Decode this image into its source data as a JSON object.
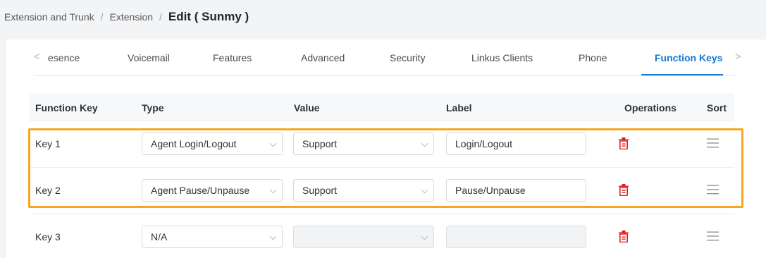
{
  "breadcrumb": {
    "items": [
      "Extension and Trunk",
      "Extension"
    ],
    "separator": "/",
    "current": "Edit ( Sunmy )"
  },
  "tabs": {
    "prev_icon": "chevron-left-icon",
    "next_icon": "chevron-right-icon",
    "prev_glyph": "<",
    "next_glyph": ">",
    "items": [
      "esence",
      "Voicemail",
      "Features",
      "Advanced",
      "Security",
      "Linkus Clients",
      "Phone",
      "Function Keys"
    ],
    "active": "Function Keys",
    "active_color": "#1677d2"
  },
  "table": {
    "headers": [
      "Function Key",
      "Type",
      "Value",
      "Label",
      "Operations",
      "Sort"
    ],
    "rows": [
      {
        "key": "Key 1",
        "type": "Agent Login/Logout",
        "value": "Support",
        "label": "Login/Logout",
        "disabled": false
      },
      {
        "key": "Key 2",
        "type": "Agent Pause/Unpause",
        "value": "Support",
        "label": "Pause/Unpause",
        "disabled": false
      },
      {
        "key": "Key 3",
        "type": "N/A",
        "value": "",
        "label": "",
        "disabled": true
      }
    ],
    "operation_icon": "trash-icon",
    "sort_icon": "drag-handle-icon"
  },
  "highlight_color": "#f5a623",
  "delete_color": "#e02020"
}
